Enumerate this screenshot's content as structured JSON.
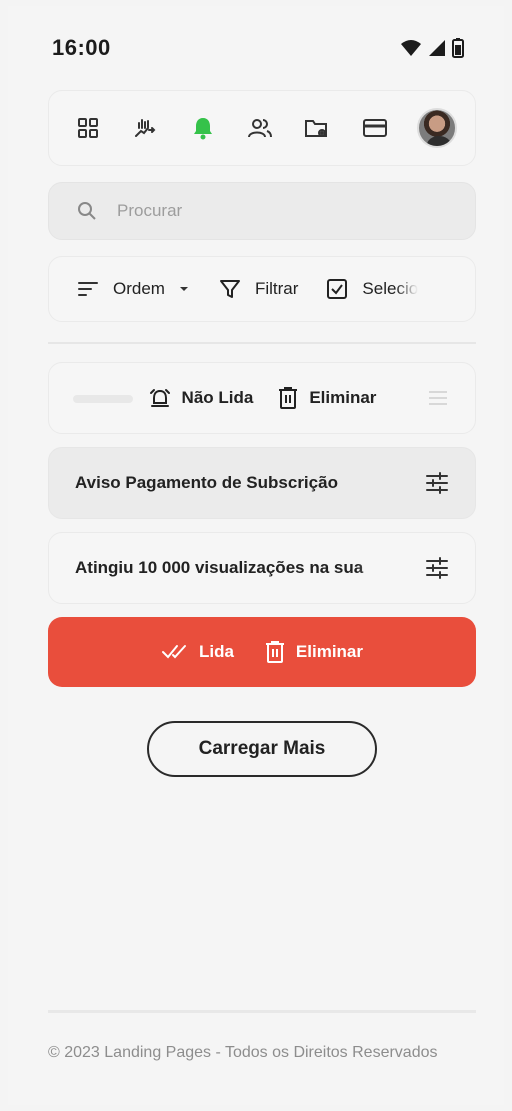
{
  "status_bar": {
    "time": "16:00"
  },
  "nav": {
    "icons": [
      "dashboard-icon",
      "pricing-icon",
      "notifications-bell-icon",
      "team-icon",
      "folder-settings-icon",
      "payment-card-icon"
    ],
    "active_color": "#35c24a"
  },
  "search": {
    "placeholder": "Procurar"
  },
  "toolbar": {
    "order_label": "Ordem",
    "filter_label": "Filtrar",
    "select_label": "Selecio"
  },
  "notifications": {
    "swiped": {
      "unread_label": "Não Lida",
      "delete_label": "Eliminar"
    },
    "items": [
      {
        "title": "Aviso Pagamento de Subscrição"
      },
      {
        "title": "Atingiu 10 000 visualizações na sua"
      }
    ],
    "swipe_bar": {
      "read_label": "Lida",
      "delete_label": "Eliminar",
      "color": "#e94e3c"
    }
  },
  "load_more_label": "Carregar Mais",
  "footer": {
    "copyright": "© 2023 Landing Pages - Todos os Direitos Reservados"
  }
}
